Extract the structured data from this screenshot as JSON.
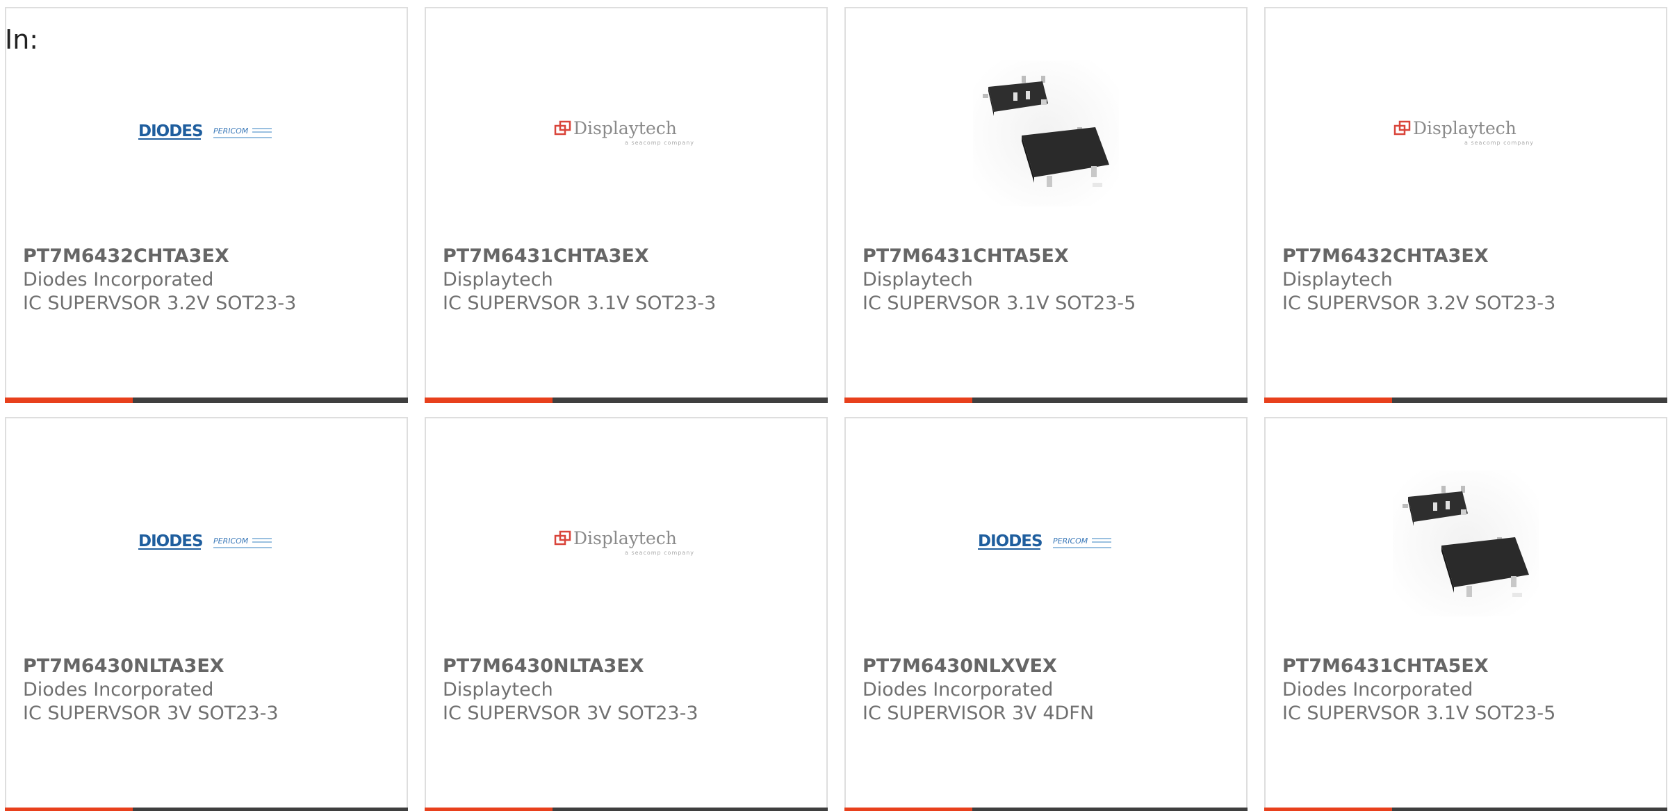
{
  "header": {
    "label": "In:"
  },
  "colors": {
    "accent": "#e8401c",
    "bar": "#3f3f3f",
    "text": "#666666",
    "border": "#dedede"
  },
  "products": [
    {
      "part": "PT7M6432CHTA3EX",
      "manufacturer": "Diodes Incorporated",
      "description": "IC SUPERVSOR 3.2V SOT23-3",
      "image": "diodes-logo"
    },
    {
      "part": "PT7M6431CHTA3EX",
      "manufacturer": "Displaytech",
      "description": "IC SUPERVSOR 3.1V SOT23-3",
      "image": "displaytech-logo"
    },
    {
      "part": "PT7M6431CHTA5EX",
      "manufacturer": "Displaytech",
      "description": "IC SUPERVSOR 3.1V SOT23-5",
      "image": "sot23-chip-photo"
    },
    {
      "part": "PT7M6432CHTA3EX",
      "manufacturer": "Displaytech",
      "description": "IC SUPERVSOR 3.2V SOT23-3",
      "image": "displaytech-logo"
    },
    {
      "part": "PT7M6430NLTA3EX",
      "manufacturer": "Diodes Incorporated",
      "description": "IC SUPERVSOR 3V SOT23-3",
      "image": "diodes-logo"
    },
    {
      "part": "PT7M6430NLTA3EX",
      "manufacturer": "Displaytech",
      "description": "IC SUPERVSOR 3V SOT23-3",
      "image": "displaytech-logo"
    },
    {
      "part": "PT7M6430NLXVEX",
      "manufacturer": "Diodes Incorporated",
      "description": "IC SUPERVISOR 3V 4DFN",
      "image": "diodes-logo"
    },
    {
      "part": "PT7M6431CHTA5EX",
      "manufacturer": "Diodes Incorporated",
      "description": "IC SUPERVSOR 3.1V SOT23-5",
      "image": "sot23-chip-photo"
    }
  ]
}
